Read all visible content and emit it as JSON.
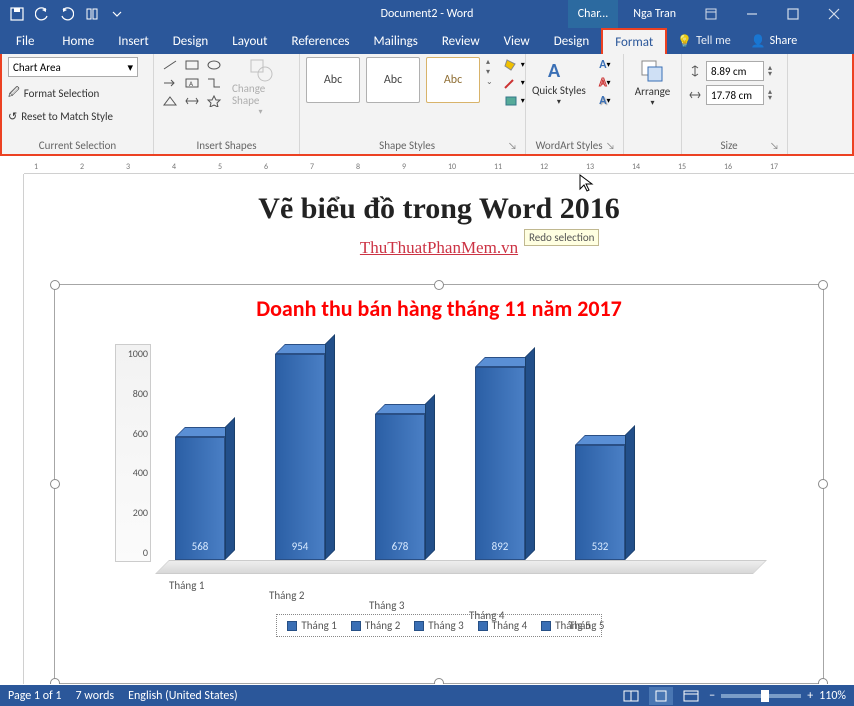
{
  "titlebar": {
    "document_title": "Document2 - Word",
    "tool_tab": "Char...",
    "account": "Nga Tran"
  },
  "menu": {
    "items": [
      "File",
      "Home",
      "Insert",
      "Design",
      "Layout",
      "References",
      "Mailings",
      "Review",
      "View",
      "Design"
    ],
    "active": "Format",
    "tellme": "Tell me",
    "share": "Share"
  },
  "ribbon": {
    "current_selection": {
      "label": "Current Selection",
      "dropdown": "Chart Area",
      "format_selection": "Format Selection",
      "reset": "Reset to Match Style"
    },
    "insert_shapes": {
      "label": "Insert Shapes",
      "change_shape": "Change Shape"
    },
    "shape_styles": {
      "label": "Shape Styles",
      "abc": "Abc"
    },
    "wordart_styles": {
      "label": "WordArt Styles",
      "quick": "Quick Styles"
    },
    "arrange": {
      "label": "Arrange",
      "button": "Arrange"
    },
    "size": {
      "label": "Size",
      "h": "8.89 cm",
      "w": "17.78 cm"
    }
  },
  "document": {
    "title": "Vẽ biểu đồ trong Word 2016",
    "subtitle": "ThuThuatPhanMem.vn",
    "tooltip": "Redo selection"
  },
  "chart_data": {
    "type": "bar",
    "title": "Doanh thu bán hàng tháng 11 năm 2017",
    "categories": [
      "Tháng 1",
      "Tháng 2",
      "Tháng 3",
      "Tháng 4",
      "Tháng 5"
    ],
    "values": [
      568,
      954,
      678,
      892,
      532
    ],
    "ylim": [
      0,
      1000
    ],
    "yticks": [
      0,
      200,
      400,
      600,
      800,
      1000
    ],
    "legend": [
      "Tháng 1",
      "Tháng 2",
      "Tháng 3",
      "Tháng 4",
      "Tháng 5"
    ]
  },
  "ruler": {
    "ticks": [
      1,
      2,
      3,
      4,
      5,
      6,
      7,
      8,
      9,
      10,
      11,
      12,
      13,
      14,
      15,
      16,
      17
    ]
  },
  "statusbar": {
    "page": "Page 1 of 1",
    "words": "7 words",
    "lang": "English (United States)",
    "zoom": "110%"
  }
}
